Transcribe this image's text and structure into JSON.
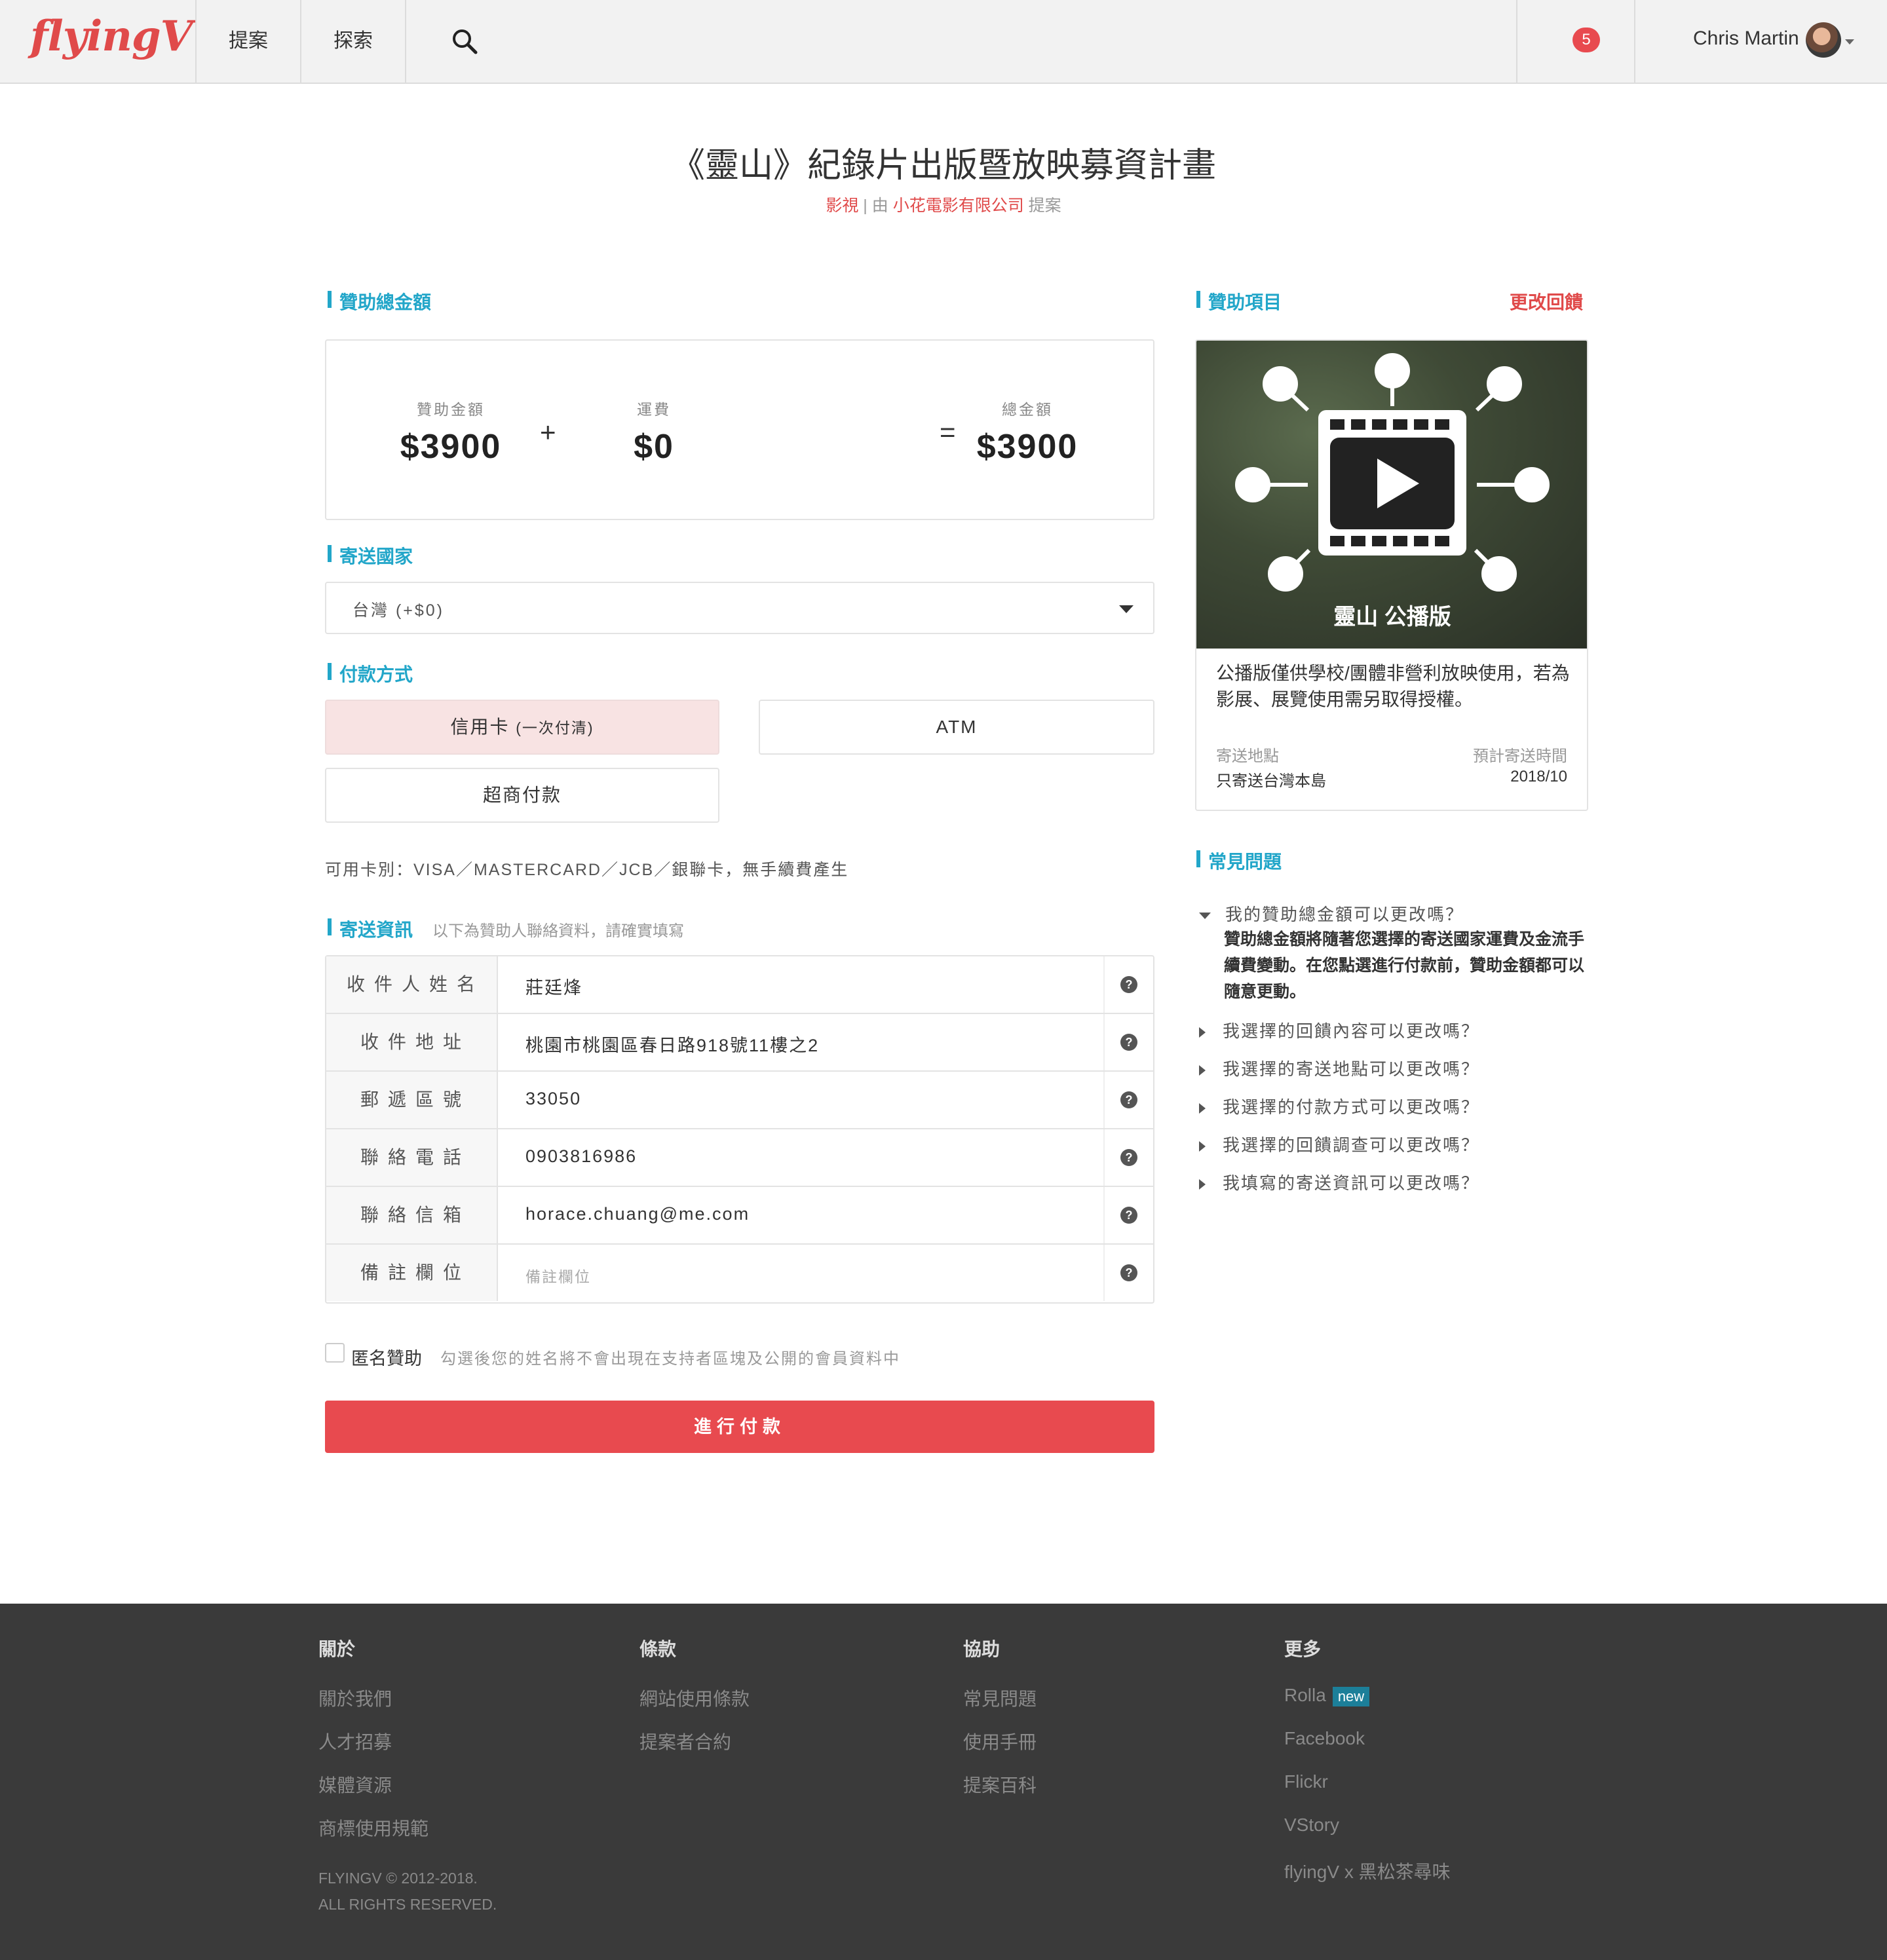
{
  "nav": {
    "logo": "flyingV",
    "links": [
      "提案",
      "探索"
    ],
    "notification_count": "5",
    "user_name": "Chris Martin"
  },
  "project": {
    "title": "《靈山》紀錄片出版暨放映募資計畫",
    "category": "影視",
    "separator": "|",
    "by": "由",
    "proposer": "小花電影有限公司",
    "proposed": "提案"
  },
  "sections": {
    "total": "贊助總金額",
    "country": "寄送國家",
    "payment": "付款方式",
    "shipping": "寄送資訊",
    "shipping_hint": "以下為贊助人聯絡資料，請確實填寫",
    "reward": "贊助項目",
    "change_reward": "更改回饋",
    "faq": "常見問題"
  },
  "amounts": {
    "pledge_label": "贊助金額",
    "pledge_value": "$3900",
    "plus": "+",
    "shipping_label": "運費",
    "shipping_value": "$0",
    "equals": "=",
    "total_label": "總金額",
    "total_value": "$3900"
  },
  "country_select": {
    "value": "台灣 (+$0)"
  },
  "payment": {
    "credit": "信用卡",
    "credit_note": "(一次付清)",
    "atm": "ATM",
    "convenience": "超商付款",
    "card_info": "可用卡別：VISA／MASTERCARD／JCB／銀聯卡，無手續費產生"
  },
  "form": {
    "rows": [
      {
        "label": "收件人姓名",
        "value": "莊廷烽"
      },
      {
        "label": "收件地址",
        "value": "桃園市桃園區春日路918號11樓之2"
      },
      {
        "label": "郵遞區號",
        "value": "33050"
      },
      {
        "label": "聯絡電話",
        "value": "0903816986"
      },
      {
        "label": "聯絡信箱",
        "value": "horace.chuang@me.com"
      },
      {
        "label": "備註欄位",
        "placeholder": "備註欄位"
      }
    ],
    "help": "?"
  },
  "anonymous": {
    "label": "匿名贊助",
    "hint": "勾選後您的姓名將不會出現在支持者區塊及公開的會員資料中"
  },
  "submit": "進行付款",
  "reward": {
    "image_caption": "靈山 公播版",
    "description": "公播版僅供學校/團體非營利放映使用，若為影展、展覽使用需另取得授權。",
    "ship_label": "寄送地點",
    "ship_value": "只寄送台灣本島",
    "eta_label": "預計寄送時間",
    "eta_value": "2018/10"
  },
  "faq": {
    "open_q": "我的贊助總金額可以更改嗎？",
    "open_a": "贊助總金額將隨著您選擇的寄送國家運費及金流手續費變動。在您點選進行付款前，贊助金額都可以隨意更動。",
    "items": [
      "我選擇的回饋內容可以更改嗎？",
      "我選擇的寄送地點可以更改嗎？",
      "我選擇的付款方式可以更改嗎？",
      "我選擇的回饋調查可以更改嗎？",
      "我填寫的寄送資訊可以更改嗎？"
    ]
  },
  "footer": {
    "about": {
      "title": "關於",
      "links": [
        "關於我們",
        "人才招募",
        "媒體資源",
        "商標使用規範"
      ]
    },
    "terms": {
      "title": "條款",
      "links": [
        "網站使用條款",
        "提案者合約"
      ]
    },
    "help": {
      "title": "協助",
      "links": [
        "常見問題",
        "使用手冊",
        "提案百科"
      ]
    },
    "more": {
      "title": "更多",
      "links": [
        "Rolla",
        "Facebook",
        "Flickr",
        "VStory",
        "flyingV x 黑松茶尋味"
      ],
      "new_badge": "new"
    },
    "copyright_1": "FLYINGV © 2012-2018.",
    "copyright_2": "ALL RIGHTS RESERVED."
  },
  "colors": {
    "brand_red": "#e04a4a",
    "accent_blue": "#22a6c9",
    "submit_red": "#e84a4f",
    "footer_bg": "#3a3a3a",
    "new_badge": "#1c7f99"
  },
  "icons": [
    "search-icon",
    "notification-badge",
    "avatar",
    "dropdown-caret",
    "help-icon",
    "film-reel-icon",
    "triangle-right-icon",
    "triangle-down-icon"
  ]
}
